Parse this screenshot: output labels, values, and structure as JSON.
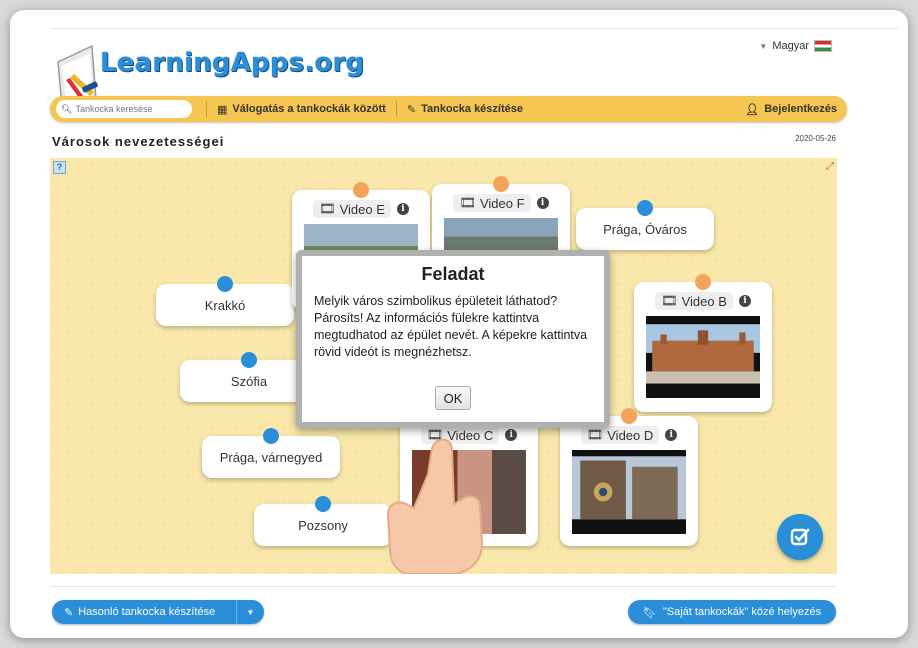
{
  "header": {
    "logo_text": "LearningApps.org",
    "language": "Magyar"
  },
  "nav": {
    "search_placeholder": "Tankocka keresése",
    "browse": "Válogatás a tankockák között",
    "create": "Tankocka készítése",
    "login": "Bejelentkezés"
  },
  "page": {
    "title": "Városok nevezetességei",
    "date": "2020-05-26"
  },
  "cards": {
    "labels": [
      "Krakkó",
      "Szófia",
      "Prága, várnegyed",
      "Pozsony",
      "Prága, Óváros"
    ],
    "videos": [
      "Video E",
      "Video F",
      "Video B",
      "Video C",
      "Video D"
    ]
  },
  "dialog": {
    "title": "Feladat",
    "text": "Melyik város szimbolikus épületeit láthatod? Párosíts! Az információs fülekre kattintva megtudhatod az épület nevét. A képekre kattintva rövid videót is megnézhetsz.",
    "ok": "OK"
  },
  "footer": {
    "similar": "Hasonló tankocka készítése",
    "own": "\"Saját tankockák\" közé helyezés"
  },
  "colors": {
    "accent_blue": "#2a8fd8",
    "nav_yellow": "#f6c652",
    "board_bg": "#f8e7a8",
    "dot_orange": "#f4a45a"
  }
}
